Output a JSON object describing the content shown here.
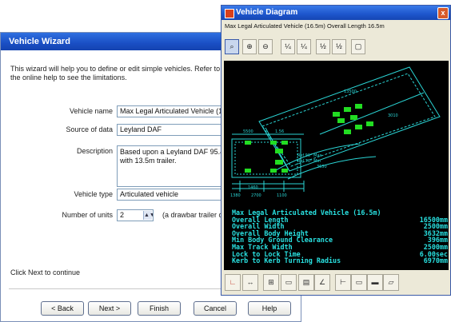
{
  "wizard": {
    "title": "Vehicle Wizard",
    "intro_line1": "This wizard will help you to define or edit simple vehicles.  Refer to",
    "intro_line2": "the online help to see the limitations.",
    "vehicle_name_label": "Vehicle name",
    "vehicle_name_value": "Max Legal Articulated Vehicle (16",
    "source_label": "Source of data",
    "source_value": "Leyland DAF",
    "description_label": "Description",
    "description_value": "Based upon a Leyland DAF 95.4\nwith 13.5m trailer.",
    "vehicle_type_label": "Vehicle type",
    "vehicle_type_value": "Articulated vehicle",
    "units_label": "Number of units",
    "units_value": "2",
    "units_hint": "(a drawbar trailer c",
    "note": "Click Next to continue",
    "buttons": {
      "back": "< Back",
      "next": "Next >",
      "finish": "Finish",
      "cancel": "Cancel",
      "help": "Help"
    }
  },
  "diagram": {
    "title": "Vehicle Diagram",
    "subtitle": "Max Legal Articulated Vehicle (16.5m)  Overall Length 16.5m",
    "close_glyph": "x",
    "toolbar": [
      "select",
      "zoom-in",
      "zoom-out",
      "zoom-a",
      "zoom-b",
      "zoom-c",
      "zoom-d",
      "fit"
    ],
    "drawing_labels": [
      "13500",
      "5500",
      "1.56",
      "3010",
      "1380",
      "2700",
      "1100",
      "1460",
      "Ref 90° Max",
      "Ref 70° Min",
      "3650"
    ],
    "info_title": "Max Legal Articulated Vehicle (16.5m)",
    "info_rows": [
      {
        "label": "Overall Length",
        "value": "16500mm"
      },
      {
        "label": "Overall Width",
        "value": "2500mm"
      },
      {
        "label": "Overall Body Height",
        "value": "3632mm"
      },
      {
        "label": "Min Body Ground Clearance",
        "value": "396mm"
      },
      {
        "label": "Max Track Width",
        "value": "2500mm"
      },
      {
        "label": "Lock to Lock Time",
        "value": "6.00sec"
      },
      {
        "label": "Kerb to Kerb Turning Radius",
        "value": "6970mm"
      }
    ],
    "colors": {
      "canvas": "#000000",
      "lines": "#2ad4d4",
      "wheels": "#22dd22",
      "text": "#29e0e0"
    }
  }
}
